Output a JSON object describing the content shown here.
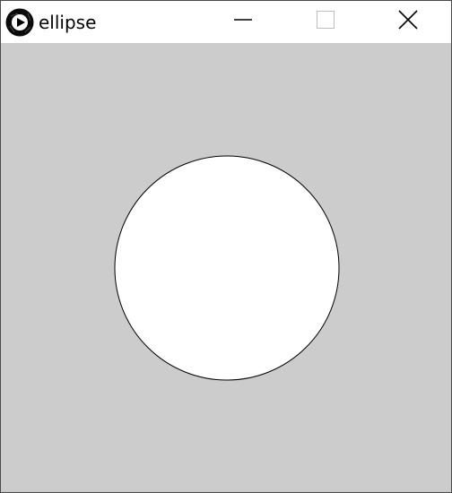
{
  "window": {
    "title": "ellipse",
    "controls": {
      "minimize_icon": "minimize-icon",
      "maximize_icon": "maximize-icon",
      "close_icon": "close-icon"
    },
    "app_icon": "processing-play-icon"
  },
  "canvas": {
    "background_color": "#cccccc",
    "shape": {
      "type": "ellipse",
      "fill": "#ffffff",
      "stroke": "#000000"
    }
  }
}
